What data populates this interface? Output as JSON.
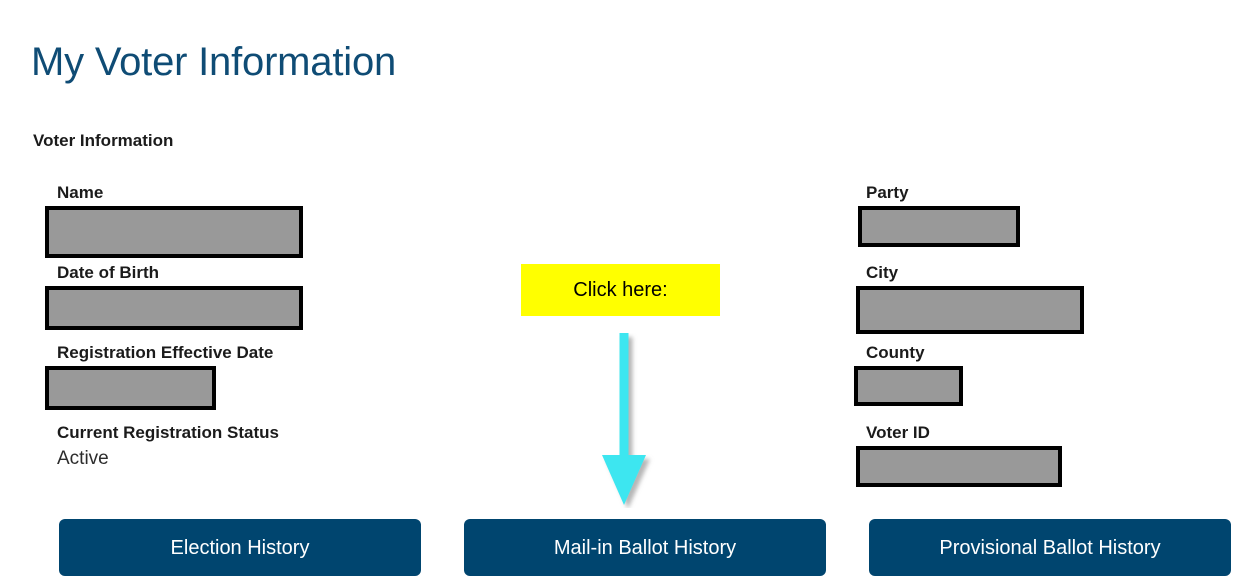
{
  "page": {
    "title": "My Voter Information",
    "section_title": "Voter Information",
    "background_color": "#ffffff",
    "title_color": "#0f4c75"
  },
  "fields": {
    "left": [
      {
        "label": "Name",
        "value": "",
        "redacted": true
      },
      {
        "label": "Date of Birth",
        "value": "",
        "redacted": true
      },
      {
        "label": "Registration Effective Date",
        "value": "",
        "redacted": true
      },
      {
        "label": "Current Registration Status",
        "value": "Active",
        "redacted": false
      }
    ],
    "right": [
      {
        "label": "Party",
        "value": "",
        "redacted": true
      },
      {
        "label": "City",
        "value": "",
        "redacted": true
      },
      {
        "label": "County",
        "value": "",
        "redacted": true
      },
      {
        "label": "Voter ID",
        "value": "",
        "redacted": true
      }
    ]
  },
  "annotation": {
    "callout_text": "Click here:",
    "callout_color": "#ffff00",
    "callout_text_color": "#000000",
    "arrow_icon": "arrow-down-icon",
    "arrow_color": "#3ee6f0",
    "arrow_direction": "down"
  },
  "buttons": [
    {
      "label": "Election History",
      "color": "#00456f"
    },
    {
      "label": "Mail-in Ballot History",
      "color": "#00456f"
    },
    {
      "label": "Provisional Ballot History",
      "color": "#00456f"
    }
  ],
  "redaction": {
    "fill_color": "#999999",
    "border_color": "#000000"
  }
}
